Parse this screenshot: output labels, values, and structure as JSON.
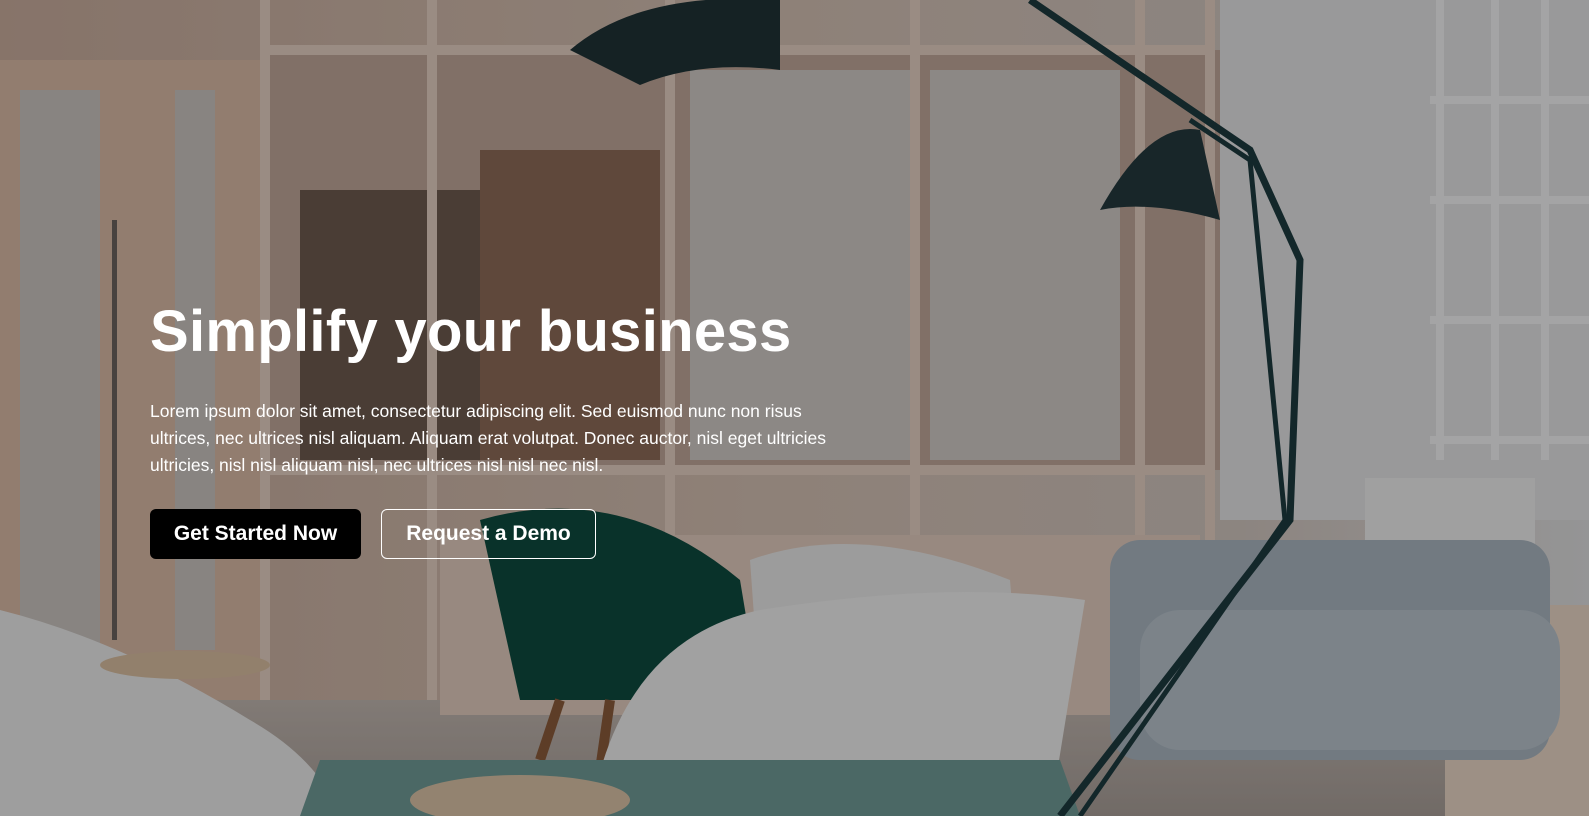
{
  "hero": {
    "title": "Simplify your business",
    "description": "Lorem ipsum dolor sit amet, consectetur adipiscing elit. Sed euismod nunc non risus ultrices, nec ultrices nisl aliquam. Aliquam erat volutpat. Donec auctor, nisl eget ultricies ultricies, nisl nisl aliquam nisl, nec ultrices nisl nisl nec nisl.",
    "primary_button_label": "Get Started Now",
    "secondary_button_label": "Request a Demo"
  },
  "colors": {
    "text": "#ffffff",
    "primary_button_bg": "#000000",
    "overlay": "rgba(0,0,0,0.32)"
  }
}
